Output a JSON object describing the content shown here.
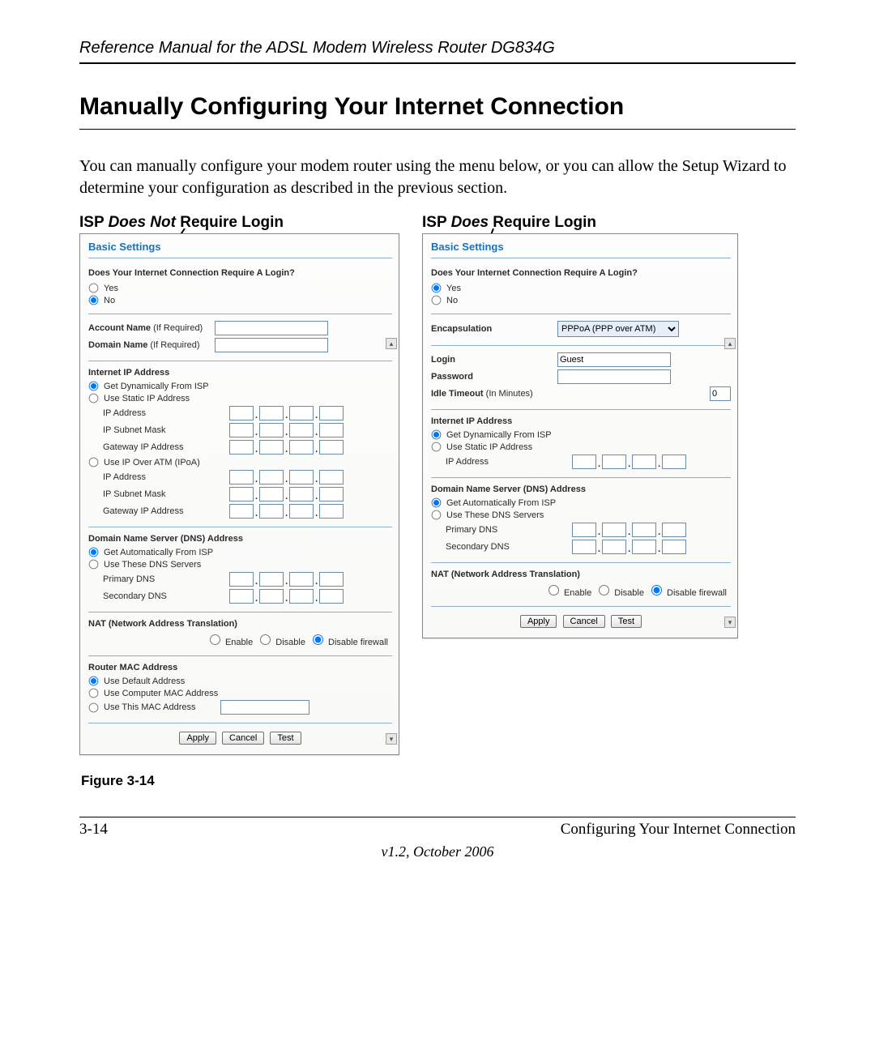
{
  "header": "Reference Manual for the ADSL Modem Wireless Router DG834G",
  "section_title": "Manually Configuring Your Internet Connection",
  "intro": "You can manually configure your modem router using the menu below, or you can allow the Setup Wizard to determine your configuration as described in the previous section.",
  "left_heading_pre": "ISP ",
  "left_heading_em": "Does Not",
  "left_heading_post": " Require Login",
  "right_heading_pre": "ISP ",
  "right_heading_em": "Does",
  "right_heading_post": " Require Login",
  "panel": {
    "title": "Basic Settings",
    "prompt": "Does Your Internet Connection Require A Login?",
    "yes": "Yes",
    "no": "No",
    "account_name": "Account Name",
    "if_required": "  (If Required)",
    "domain_name": "Domain Name",
    "internet_ip": "Internet IP Address",
    "get_dyn": "Get Dynamically From ISP",
    "use_static": "Use Static IP Address",
    "ip_address": "IP Address",
    "ip_subnet": "IP Subnet Mask",
    "gateway_ip": "Gateway IP Address",
    "use_ipoa": "Use IP Over ATM (IPoA)",
    "dns_header": "Domain Name Server (DNS) Address",
    "dns_auto": "Get Automatically From ISP",
    "dns_use": "Use These DNS Servers",
    "primary_dns": "Primary DNS",
    "secondary_dns": "Secondary DNS",
    "nat_header": "NAT (Network Address Translation)",
    "nat_enable": "Enable",
    "nat_disable": "Disable",
    "nat_disable_fw": "Disable firewall",
    "mac_header": "Router MAC Address",
    "mac_default": "Use Default Address",
    "mac_computer": "Use Computer MAC Address",
    "mac_this": "Use This MAC Address",
    "apply": "Apply",
    "cancel": "Cancel",
    "test": "Test",
    "encapsulation": "Encapsulation",
    "encaps_value": "PPPoA (PPP over ATM)",
    "login": "Login",
    "login_value": "Guest",
    "password": "Password",
    "idle": "Idle Timeout",
    "idle_suffix": " (In Minutes)",
    "idle_value": "0"
  },
  "figure_caption": "Figure 3-14",
  "footer_left": "3-14",
  "footer_right": "Configuring Your Internet Connection",
  "version": "v1.2, October 2006"
}
